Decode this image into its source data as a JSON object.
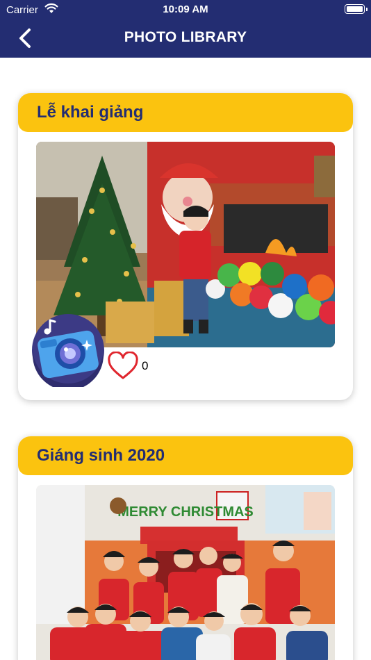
{
  "status_bar": {
    "carrier": "Carrier",
    "time": "10:09 AM"
  },
  "nav": {
    "title": "PHOTO LIBRARY",
    "back_icon": "chevron-left-icon"
  },
  "albums": [
    {
      "title": "Lễ khai giảng",
      "like_count": "0",
      "photo": "child-christmas-tree-santa-backdrop"
    },
    {
      "title": "Giáng sinh 2020",
      "photo": "class-group-merry-christmas",
      "banner_text": "MERRY CHRISTMAS"
    }
  ],
  "colors": {
    "nav": "#232d72",
    "card_header": "#fbc30f",
    "title_text": "#232d72",
    "heart": "#e0262e"
  }
}
